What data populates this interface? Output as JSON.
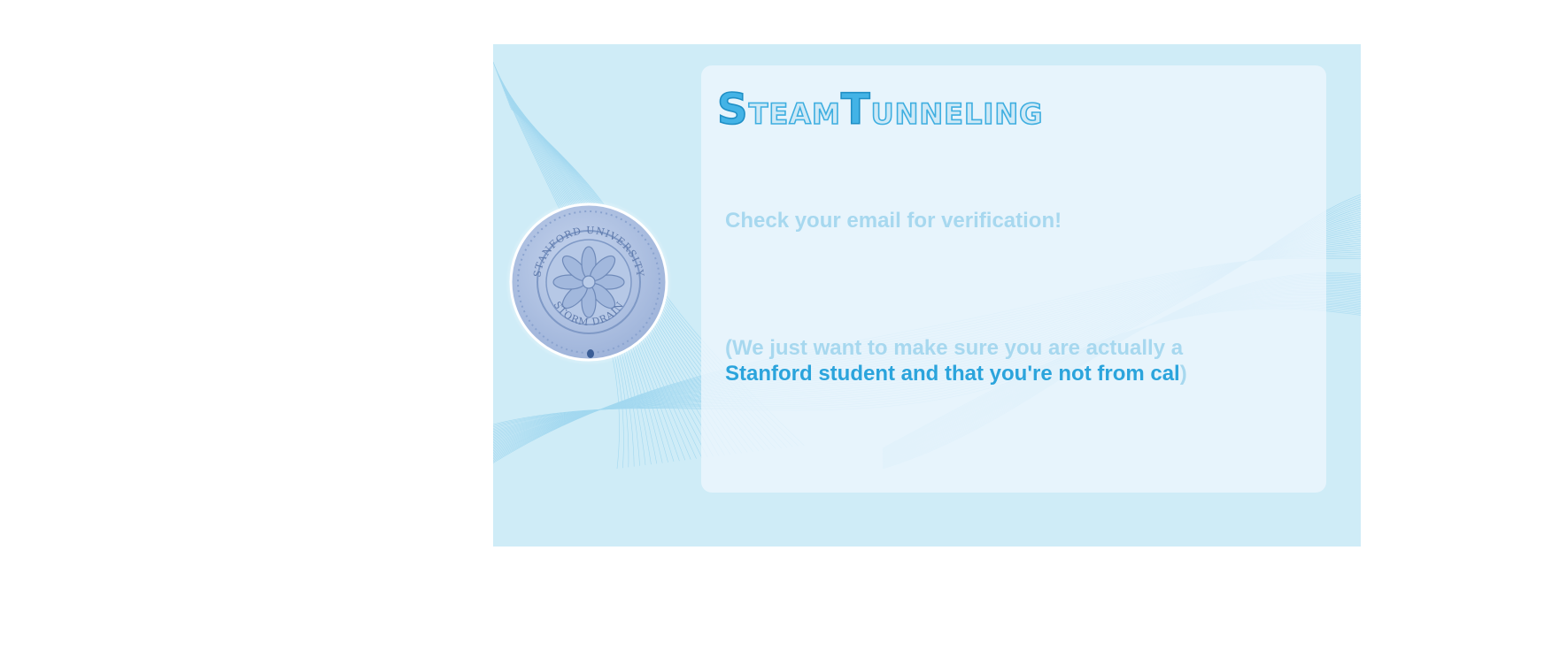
{
  "brand": {
    "logo_text": "SteamTunneling",
    "seal_text_top": "STANFORD UNIVERSITY",
    "seal_text_bottom": "STORM DRAIN"
  },
  "message": {
    "heading": "Check your email for verification!",
    "note_open": "(We just want to make sure you are actually a",
    "note_emphasis": "Stanford student and that you're not from cal",
    "note_close": ")"
  },
  "colors": {
    "panel_background": "#cfecf7",
    "card_background": "#ecf5fc",
    "accent_blue": "#2ba4dc",
    "faded_blue": "#a7d8ef",
    "seal_blue": "#9fb7dc"
  }
}
